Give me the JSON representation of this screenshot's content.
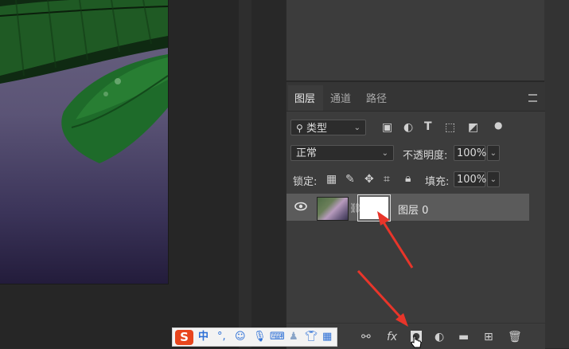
{
  "layers_panel": {
    "tabs": [
      {
        "label": "图层"
      },
      {
        "label": "通道"
      },
      {
        "label": "路径"
      }
    ],
    "filter": {
      "value": "类型"
    },
    "blend_mode": {
      "value": "正常"
    },
    "opacity": {
      "label": "不透明度:",
      "value": "100%"
    },
    "lock": {
      "label": "锁定:"
    },
    "fill": {
      "label": "填充:",
      "value": "100%"
    },
    "layers": [
      {
        "name": "图层 0"
      }
    ],
    "bottom_icons": [
      "link-icon",
      "fx-icon",
      "add-mask-icon",
      "adjustment-icon",
      "folder-icon",
      "new-layer-icon",
      "trash-icon"
    ],
    "fx_label": "fx"
  },
  "ime_toolbar": {
    "logo": "S",
    "mode": "中",
    "punct": "°,",
    "items": [
      "emoji-icon",
      "mic-icon",
      "keyboard-icon",
      "user-icon",
      "shirt-icon",
      "grid-icon"
    ]
  },
  "colors": {
    "panel": "#3c3c3c",
    "selected_row": "#5b5b5b",
    "annotation_arrow": "#e8352a"
  }
}
